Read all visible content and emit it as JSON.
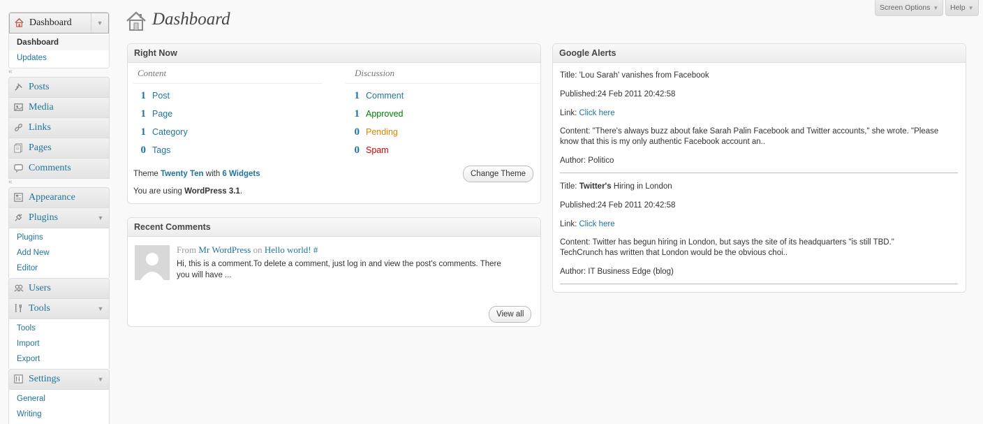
{
  "header": {
    "title": "Dashboard",
    "screen_options": "Screen Options",
    "help": "Help"
  },
  "menu": {
    "dashboard": {
      "label": "Dashboard",
      "items": [
        "Dashboard",
        "Updates"
      ]
    },
    "group1": [
      "Posts",
      "Media",
      "Links",
      "Pages",
      "Comments"
    ],
    "appearance": "Appearance",
    "plugins": {
      "label": "Plugins",
      "items": [
        "Plugins",
        "Add New",
        "Editor"
      ]
    },
    "users": "Users",
    "tools": {
      "label": "Tools",
      "items": [
        "Tools",
        "Import",
        "Export"
      ]
    },
    "settings": {
      "label": "Settings",
      "items": [
        "General",
        "Writing"
      ]
    }
  },
  "right_now": {
    "title": "Right Now",
    "content_heading": "Content",
    "discussion_heading": "Discussion",
    "content": [
      {
        "n": "1",
        "label": "Post"
      },
      {
        "n": "1",
        "label": "Page"
      },
      {
        "n": "1",
        "label": "Category"
      },
      {
        "n": "0",
        "label": "Tags"
      }
    ],
    "discussion": [
      {
        "n": "1",
        "label": "Comment"
      },
      {
        "n": "1",
        "label": "Approved"
      },
      {
        "n": "0",
        "label": "Pending"
      },
      {
        "n": "0",
        "label": "Spam"
      }
    ],
    "theme_prefix": "Theme",
    "theme_name": "Twenty Ten",
    "theme_with": "with",
    "widgets": "6 Widgets",
    "change_theme": "Change Theme",
    "version_prefix": "You are using",
    "version": "WordPress 3.1",
    "version_suffix": "."
  },
  "recent_comments": {
    "title": "Recent Comments",
    "from": "From",
    "author": "Mr WordPress",
    "on": "on",
    "post": "Hello world!",
    "hash": "#",
    "excerpt_line1": "Hi, this is a comment.To delete a comment, just log in and view the post's comments. There",
    "excerpt_line2": "you will have ...",
    "view_all": "View all"
  },
  "google_alerts": {
    "title": "Google Alerts",
    "alerts": [
      {
        "title_label": "Title:",
        "title_text": "'Lou Sarah' vanishes from Facebook",
        "published": "Published:24 Feb 2011 20:42:58",
        "link_label": "Link:",
        "link_text": "Click here",
        "content_line1": "Content: \"There's always buzz about fake Sarah Palin Facebook and Twitter accounts,\" she wrote. \"Please",
        "content_line2": "know that this is my only authentic Facebook account an..",
        "author": "Author: Politico"
      },
      {
        "title_label": "Title:",
        "title_bold": "Twitter's",
        "title_text": "Hiring in London",
        "published": "Published:24 Feb 2011 20:42:58",
        "link_label": "Link:",
        "link_text": "Click here",
        "content_line1": "Content: Twitter has begun hiring in London, but says the site of its headquarters \"is still TBD.\"",
        "content_line2": "TechCrunch has written that London would be the obvious choi..",
        "author": "Author: IT Business Edge (blog)"
      }
    ]
  }
}
